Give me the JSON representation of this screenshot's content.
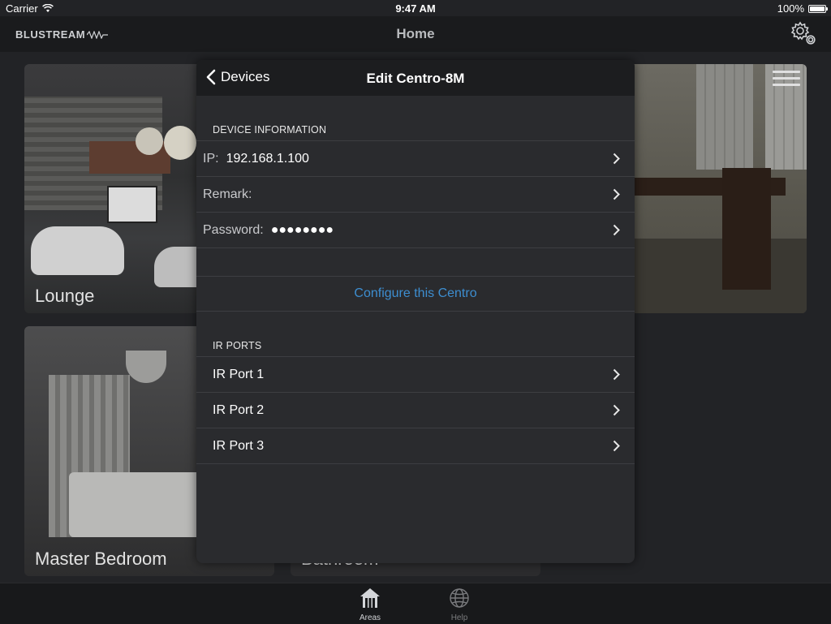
{
  "status_bar": {
    "carrier": "Carrier",
    "time": "9:47 AM",
    "battery": "100%"
  },
  "nav": {
    "logo": "BLUSTREAM",
    "title": "Home"
  },
  "tiles": {
    "lounge": "Lounge",
    "master_bedroom": "Master Bedroom",
    "bathroom": "Bathroom"
  },
  "modal": {
    "back_label": "Devices",
    "title": "Edit Centro-8M",
    "device_info_header": "DEVICE INFORMATION",
    "ip_label": "IP:",
    "ip_value": "192.168.1.100",
    "remark_label": "Remark:",
    "remark_value": "",
    "password_label": "Password:",
    "password_value": "●●●●●●●●",
    "configure_label": "Configure this Centro",
    "ir_ports_header": "IR PORTS",
    "ir_ports": [
      "IR Port 1",
      "IR Port 2",
      "IR Port 3"
    ]
  },
  "tabbar": {
    "areas": "Areas",
    "help": "Help"
  },
  "colors": {
    "accent": "#3d8ed0",
    "background": "#222326",
    "modal": "#2a2b2e"
  }
}
